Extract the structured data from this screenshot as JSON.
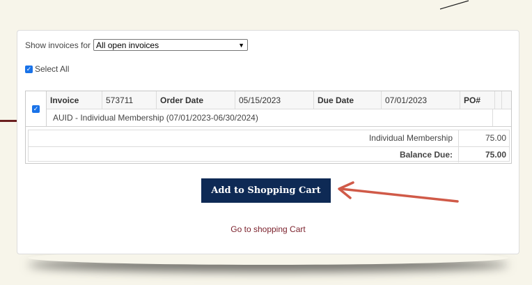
{
  "filter": {
    "label": "Show invoices for",
    "selected": "All open invoices"
  },
  "select_all": {
    "label": "Select All",
    "checked": true
  },
  "invoice": {
    "checked": true,
    "invoice_label": "Invoice",
    "invoice_number": "573711",
    "order_date_label": "Order Date",
    "order_date": "05/15/2023",
    "due_date_label": "Due Date",
    "due_date": "07/01/2023",
    "po_label": "PO#",
    "po_value": "",
    "description": "AUID - Individual Membership (07/01/2023-06/30/2024)",
    "lines": [
      {
        "label": "Individual Membership",
        "amount": "75.00"
      }
    ],
    "balance_label": "Balance Due:",
    "balance_amount": "75.00"
  },
  "actions": {
    "add_to_cart": "Add to Shopping Cart",
    "go_to_cart": "Go to shopping Cart"
  },
  "colors": {
    "page_bg": "#f7f5ea",
    "button_bg": "#0e2a55",
    "arrow": "#d05a48",
    "link": "#7a1f2a",
    "checkbox": "#1a73e8"
  }
}
